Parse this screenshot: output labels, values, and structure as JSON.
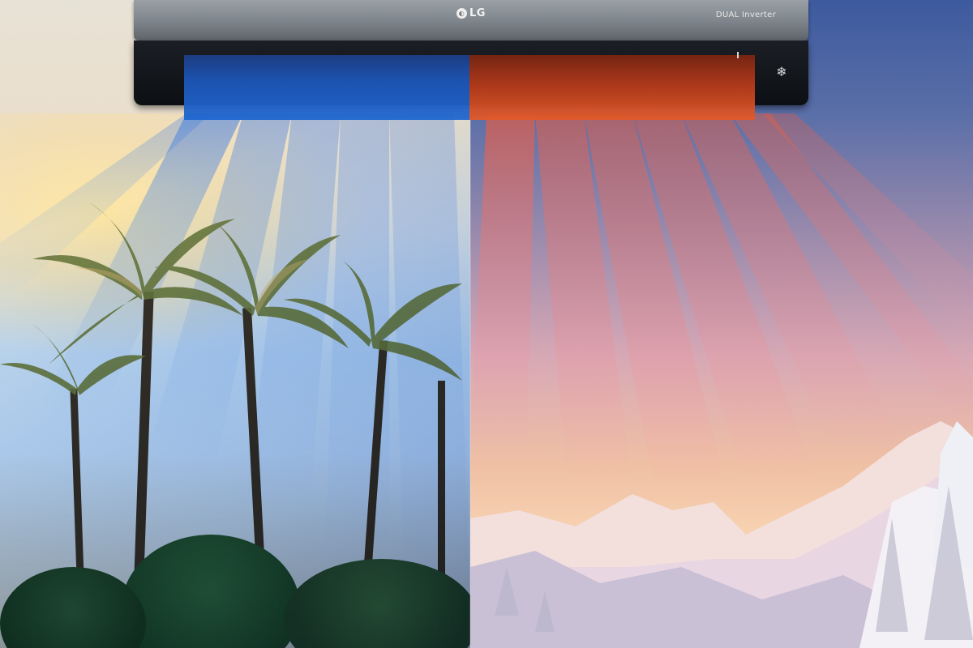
{
  "image": {
    "alt": "LG DUAL Inverter air conditioner cooling a tropical scene and heating a snowy mountain scene",
    "ac_unit": {
      "brand_logo": "LG",
      "model_label": "DUAL Inverter",
      "fan_icon": "snowflake-fan-icon"
    },
    "colors": {
      "cool_air": "#1f67d0",
      "warm_air": "#e25a2a",
      "ac_body": "#0c0f13",
      "ac_top": "#7f868d"
    }
  }
}
